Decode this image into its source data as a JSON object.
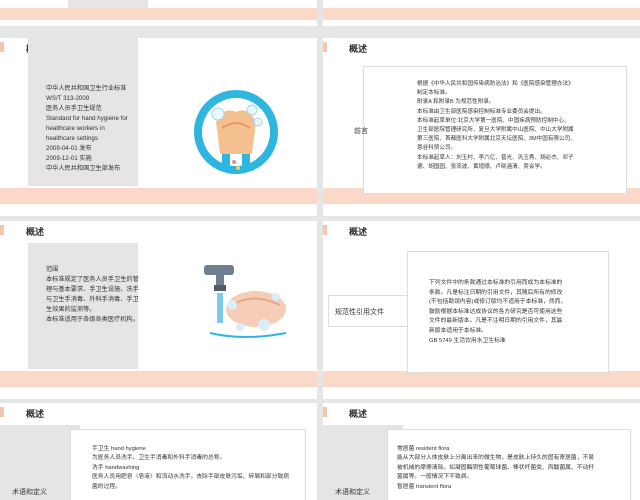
{
  "slides": {
    "s3": {
      "title": "概述",
      "lines": [
        "中华人民共和国卫生行业标准",
        "WS/T 313-2009",
        "医务人员手卫生规范",
        "Standard for hand hygiene for",
        "healthcare workers in",
        "healthcare settings",
        "2009-04-01 发布",
        "2009-12-01 实施",
        "中华人民共和国卫生部发布"
      ]
    },
    "s4": {
      "title": "概述",
      "label": "前言",
      "lines": [
        "根据《中华人民共和国传染病防治法》和《医院感染管理办法》",
        "制定本标准。",
        "附录A 和附录B 为规范性附录。",
        "本标准由卫生部医院感染控制标准专业委员会提出。",
        "本标准起草单位:北京大学第一医院、中国疾病预防控制中心、",
        "卫生部医院管理研究所、复旦大学附属中山医院、中山大学附属",
        "第三医院、首都医科大学附属北京天坛医院、3M中国有限公司、",
        "恩谷科贸公司。",
        "本标准起草人：刘玉村、李六亿、曾光、巩玉秀、胡必杰、邓子",
        "德、胡国园、张流波、黄增顺、卢晓涵清、贾会学。"
      ]
    },
    "s5": {
      "title": "概述",
      "lines": [
        "范围",
        "本标准规定了医务人员手卫生的管",
        "理与基本要求、手卫生设施、洗手",
        "与卫生手消毒、外科手消毒、手卫",
        "生效果的监测等。",
        "本标准适用于各级各类医疗机构。"
      ]
    },
    "s6": {
      "title": "概述",
      "label": "规范性引用文件",
      "lines": [
        "下列文件中的条款通过本标准的引用而成为本标准的",
        "条款。凡是标注日期的引用文件，其随后所有的修改",
        "(不包括勘误内容)或修订版均不适用于本标准，然而，",
        "鼓励根据本标准达成协议的各方研究是否可使用这些",
        "文件的最新版本。凡是不注明日期的引用文件，其最",
        "新版本适用于本标准。",
        "GB 5749 生活饮用水卫生标准"
      ]
    },
    "s7": {
      "title": "概述",
      "label": "术语和定义",
      "lines": [
        "手卫生 hand hygiene",
        "为医务人员洗手、卫生手消毒和外科手消毒的总称。",
        "洗手 handwashing",
        "医务人员用肥皂（皂液）和流动水洗手，去除手部皮肤污垢、碎屑和部分致病",
        "菌的过程。"
      ]
    },
    "s8": {
      "title": "概述",
      "label": "术语和定义",
      "lines": [
        "常居菌 resident flora",
        "能从大部分人体皮肤上分离出来的微生物，是皮肤上持久的固有寄居菌，不易",
        "被机械的摩擦清除。如凝固酶阴性葡萄球菌、棒状杆菌类、丙酸菌属、不动杆",
        "菌属等。一般情况下不致病。",
        "暂居菌 transient flora"
      ]
    }
  }
}
